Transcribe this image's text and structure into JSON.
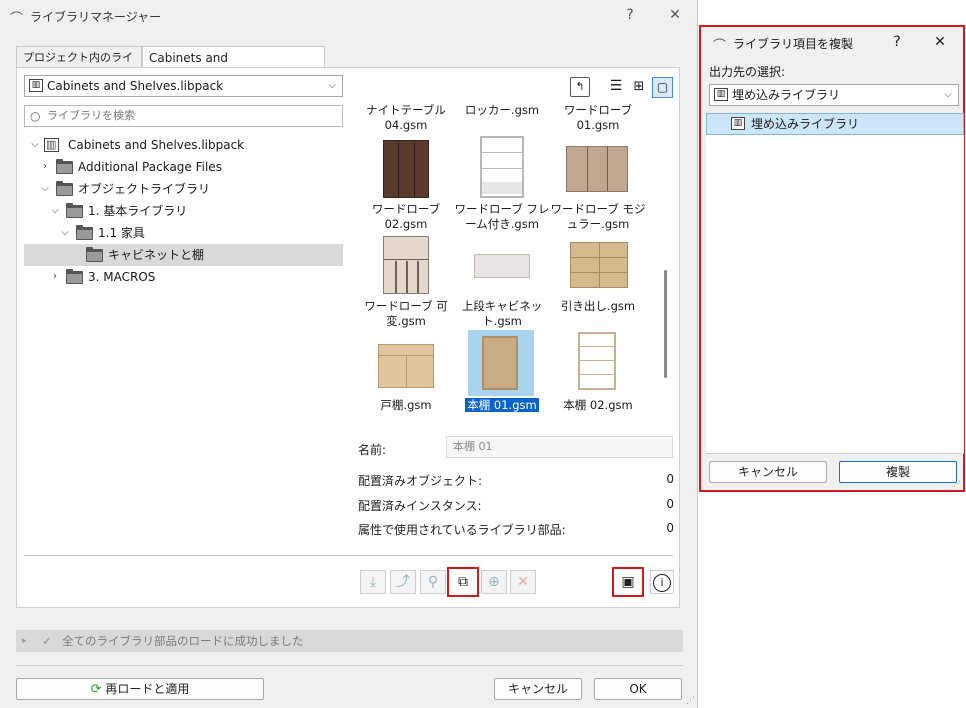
{
  "main_window": {
    "title": "ライブラリマネージャー",
    "help_label": "?",
    "close_label": "✕",
    "tabs": [
      {
        "label": "プロジェクト内のライブラリ",
        "active": false
      },
      {
        "label": "Cabinets and Shelves.libpack",
        "active": true
      }
    ],
    "library_select": {
      "value": "Cabinets and Shelves.libpack"
    },
    "search": {
      "placeholder": "ライブラリを検索"
    },
    "tree": [
      {
        "label": "Cabinets and Shelves.libpack",
        "icon": "library-icon",
        "expanded": true
      },
      {
        "label": "Additional Package Files",
        "icon": "folder-icon",
        "expanded": false
      },
      {
        "label": "オブジェクトライブラリ",
        "icon": "folder-icon",
        "expanded": true
      },
      {
        "label": "1. 基本ライブラリ",
        "icon": "folder-icon",
        "expanded": true
      },
      {
        "label": "1.1 家具",
        "icon": "folder-icon",
        "expanded": true
      },
      {
        "label": "キャビネットと棚",
        "icon": "folder-icon",
        "selected": true
      },
      {
        "label": "3. MACROS",
        "icon": "folder-icon",
        "expanded": false
      }
    ],
    "view_buttons": [
      "folder-up-icon",
      "list-view-icon",
      "grid-view-icon",
      "large-icon-view-icon"
    ],
    "grid_items": [
      {
        "label": "ナイトテーブル 04.gsm"
      },
      {
        "label": "ロッカー.gsm"
      },
      {
        "label": "ワードローブ 01.gsm"
      },
      {
        "label": "ワードローブ 02.gsm"
      },
      {
        "label": "ワードローブ フレーム付き.gsm"
      },
      {
        "label": "ワードローブ モジュラー.gsm"
      },
      {
        "label": "ワードローブ 可変.gsm"
      },
      {
        "label": "上段キャビネット.gsm"
      },
      {
        "label": "引き出し.gsm"
      },
      {
        "label": "戸棚.gsm"
      },
      {
        "label": "本棚 01.gsm",
        "selected": true
      },
      {
        "label": "本棚 02.gsm"
      }
    ],
    "info": {
      "name_label": "名前:",
      "name_value": "本棚 01",
      "placed_objects_label": "配置済みオブジェクト:",
      "placed_objects_value": "0",
      "placed_instances_label": "配置済みインスタンス:",
      "placed_instances_value": "0",
      "attr_parts_label": "属性で使用されているライブラリ部品:",
      "attr_parts_value": "0"
    },
    "toolbar_icons": [
      "add-from-file-icon",
      "export-icon",
      "new-object-icon",
      "duplicate-object-icon",
      "add-object-icon",
      "delete-icon",
      "save-icon",
      "info-icon"
    ],
    "status_message": "全てのライブラリ部品のロードに成功しました",
    "reload_button": "再ロードと適用",
    "cancel_button": "キャンセル",
    "ok_button": "OK"
  },
  "duplicate_dialog": {
    "title": "ライブラリ項目を複製",
    "help_label": "?",
    "close_label": "✕",
    "destination_label": "出力先の選択:",
    "destination_value": "埋め込みライブラリ",
    "list_item": "埋め込みライブラリ",
    "cancel_button": "キャンセル",
    "duplicate_button": "複製"
  },
  "colors": {
    "highlight_red": "#d21a1a",
    "selection_blue": "#0a64c8",
    "list_selection": "#cde6f7"
  }
}
